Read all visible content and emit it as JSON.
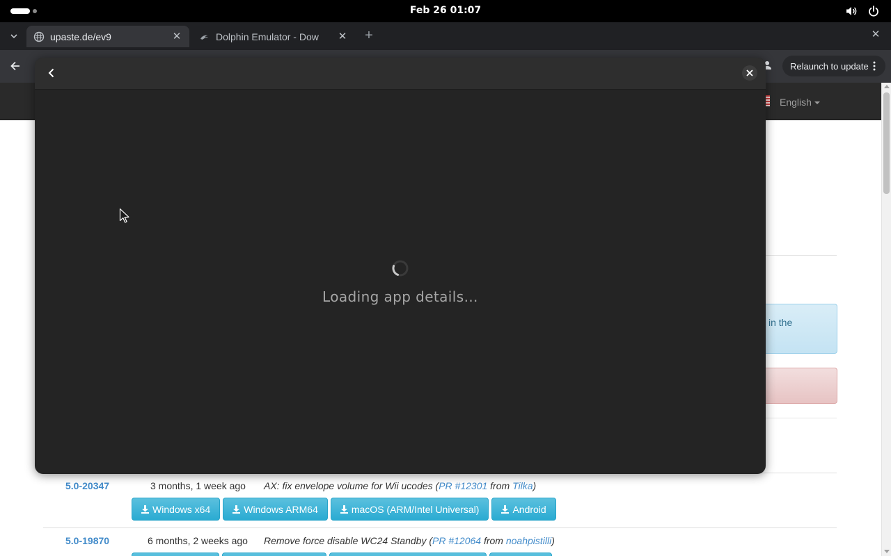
{
  "system_bar": {
    "clock": "Feb 26  01:07"
  },
  "browser": {
    "tabs": [
      {
        "title": "upaste.de/ev9",
        "active": true,
        "icon": "globe-icon"
      },
      {
        "title": "Dolphin Emulator - Dow",
        "active": false,
        "icon": "dolphin-icon"
      }
    ],
    "relaunch_label": "Relaunch to update"
  },
  "page": {
    "language": "English",
    "alert_info_text": "in the",
    "releases": [
      {
        "version": "5.0-20347",
        "when": "3 months, 1 week ago",
        "desc_prefix": "AX: fix envelope volume for Wii ucodes (",
        "pr": "PR #12301",
        "from": " from ",
        "author": "Tilka",
        "desc_suffix": ")"
      },
      {
        "version": "5.0-19870",
        "when": "6 months, 2 weeks ago",
        "desc_prefix": "Remove force disable WC24 Standby (",
        "pr": "PR #12064",
        "from": " from ",
        "author": "noahpistilli",
        "desc_suffix": ")"
      }
    ],
    "downloads": [
      "Windows x64",
      "Windows ARM64",
      "macOS (ARM/Intel Universal)",
      "Android"
    ]
  },
  "dialog": {
    "loading_text": "Loading app details…"
  },
  "colors": {
    "link": "#428bca",
    "download_button": "#31b0d5",
    "dialog_bg": "#242424"
  }
}
